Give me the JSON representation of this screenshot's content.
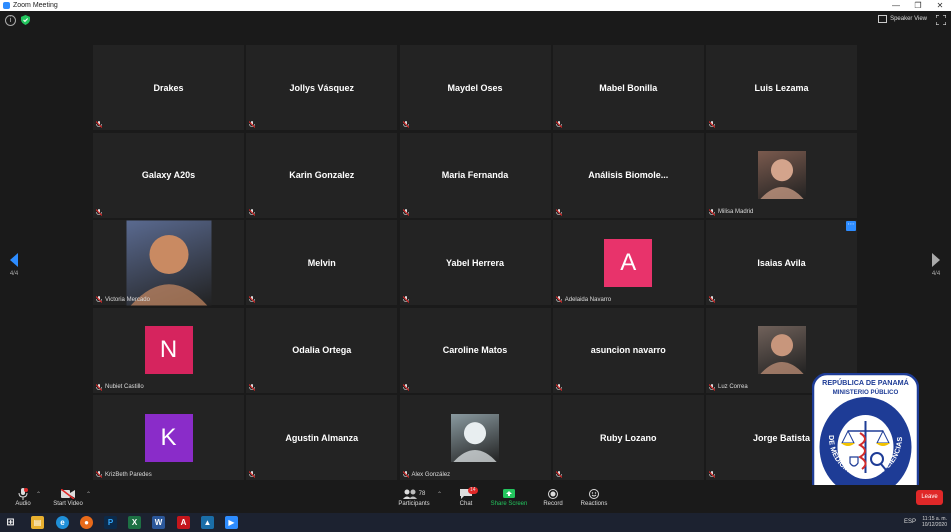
{
  "window": {
    "title": "Zoom Meeting",
    "speaker_view": "Speaker View"
  },
  "pagination": {
    "left": "4/4",
    "right": "4/4"
  },
  "participants": [
    {
      "name": "Drakes",
      "type": "name"
    },
    {
      "name": "Jollys Vásquez",
      "type": "name"
    },
    {
      "name": "Maydel Oses",
      "type": "name"
    },
    {
      "name": "Mabel Bonilla",
      "type": "name"
    },
    {
      "name": "Luis Lezama",
      "type": "name"
    },
    {
      "name": "Galaxy A20s",
      "type": "name"
    },
    {
      "name": "Karin Gonzalez",
      "type": "name"
    },
    {
      "name": "Maria Fernanda",
      "type": "name"
    },
    {
      "name": "Análisis Biomole...",
      "type": "name"
    },
    {
      "name": "Milisa Madrid",
      "type": "photo"
    },
    {
      "name": "Victoria Mercado",
      "type": "photo"
    },
    {
      "name": "Melvin",
      "type": "name"
    },
    {
      "name": "Yabel Herrera",
      "type": "name"
    },
    {
      "name": "Adelaida Navarro",
      "type": "avatar",
      "initial": "A",
      "color": "#e8336b"
    },
    {
      "name": "Isaias Avila",
      "type": "name"
    },
    {
      "name": "Nubiet Castillo",
      "type": "avatar",
      "initial": "N",
      "color": "#d6245e"
    },
    {
      "name": "Odalia Ortega",
      "type": "name"
    },
    {
      "name": "Caroline Matos",
      "type": "name"
    },
    {
      "name": "asuncion navarro",
      "type": "name"
    },
    {
      "name": "Luz Correa",
      "type": "photo"
    },
    {
      "name": "KrizBeth Paredes",
      "type": "avatar",
      "initial": "K",
      "color": "#8a2cc9"
    },
    {
      "name": "Agustin Almanza",
      "type": "name"
    },
    {
      "name": "Alex González",
      "type": "photo"
    },
    {
      "name": "Ruby Lozano",
      "type": "name"
    },
    {
      "name": "Jorge Batista",
      "type": "name"
    }
  ],
  "toolbar": {
    "audio": "Audio",
    "start_video": "Start Video",
    "participants": "Participants",
    "participants_count": "78",
    "chat": "Chat",
    "chat_count": "14",
    "share_screen": "Share Screen",
    "record": "Record",
    "reactions": "Reactions",
    "leave": "Leave"
  },
  "taskbar": {
    "time": "11:15 a. m.",
    "date": "10/12/2020",
    "language": "ESP"
  },
  "logo": {
    "top_line1": "REPÚBLICA DE PANAMÁ",
    "top_line2": "MINISTERIO PÚBLICO",
    "ring": "INSTITUTO DE MEDICINA LEGAL Y CIENCIAS FORENSES"
  },
  "colors": {
    "accent": "#2d8cff",
    "leave": "#e02828",
    "share": "#23c55e"
  }
}
